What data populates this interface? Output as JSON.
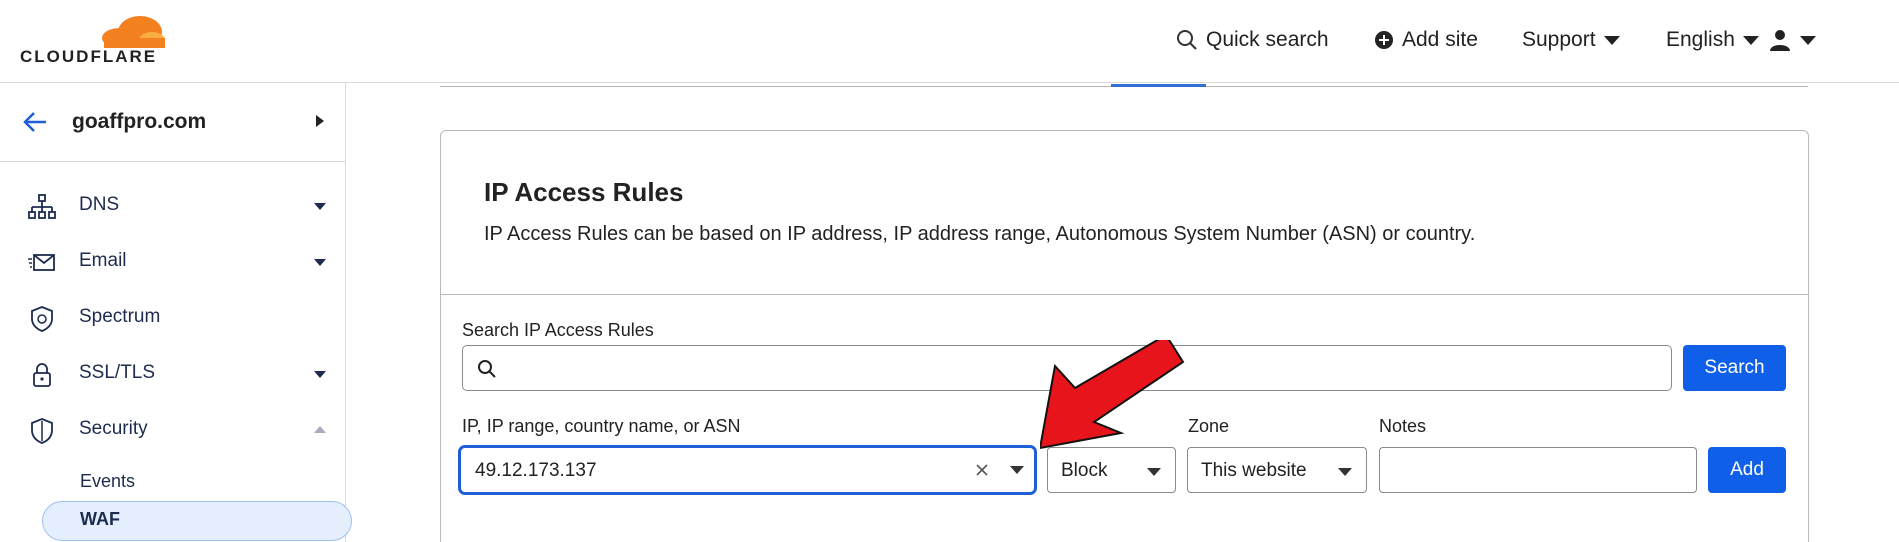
{
  "brand": {
    "name": "CLOUDFLARE",
    "accent": "#f48120",
    "primary": "#0f5fe8"
  },
  "topbar": {
    "quick_search": "Quick search",
    "add_site": "Add site",
    "support": "Support",
    "language": "English"
  },
  "sidebar": {
    "site": "goaffpro.com",
    "items": [
      {
        "label": "DNS",
        "icon": "network-icon"
      },
      {
        "label": "Email",
        "icon": "email-icon"
      },
      {
        "label": "Spectrum",
        "icon": "spectrum-icon"
      },
      {
        "label": "SSL/TLS",
        "icon": "lock-icon"
      },
      {
        "label": "Security",
        "icon": "shield-icon"
      }
    ],
    "security_sub": [
      {
        "label": "Events"
      },
      {
        "label": "WAF"
      }
    ]
  },
  "card": {
    "title": "IP Access Rules",
    "description": "IP Access Rules can be based on IP address, IP address range, Autonomous System Number (ASN) or country.",
    "search_label": "Search IP Access Rules",
    "search_button": "Search",
    "ip_label": "IP, IP range, country name, or ASN",
    "ip_value": "49.12.173.137",
    "action_value": "Block",
    "zone_label": "Zone",
    "zone_value": "This website",
    "notes_label": "Notes",
    "add_button": "Add"
  },
  "annotation": {
    "arrow_color": "#e8141c"
  }
}
